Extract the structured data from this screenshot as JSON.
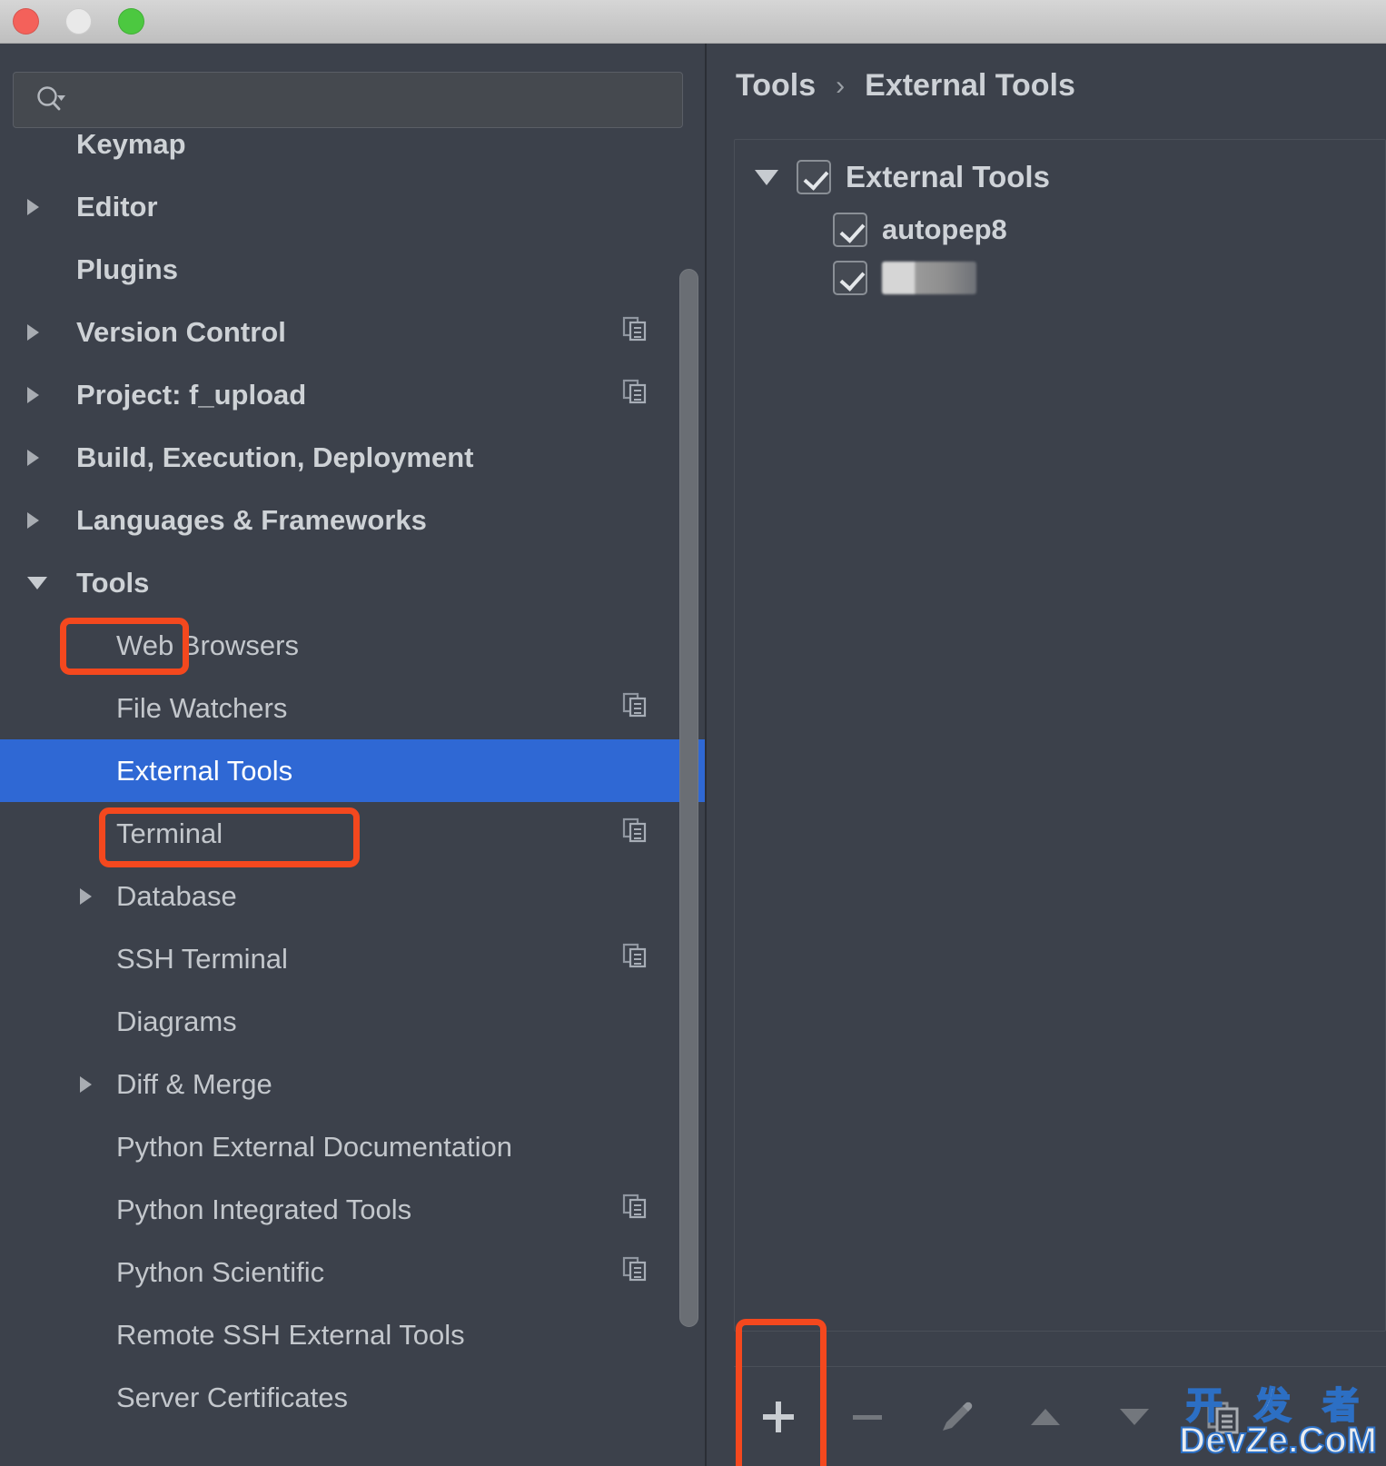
{
  "window": {
    "traffic_lights": [
      "close",
      "minimize",
      "maximize"
    ]
  },
  "search": {
    "value": "",
    "placeholder": "",
    "icon": "search-icon"
  },
  "sidebar": {
    "items": [
      {
        "label": "Keymap",
        "indent": 0,
        "arrow": "none",
        "copy": false,
        "partial": true
      },
      {
        "label": "Editor",
        "indent": 0,
        "arrow": "right",
        "copy": false
      },
      {
        "label": "Plugins",
        "indent": 0,
        "arrow": "none",
        "copy": false
      },
      {
        "label": "Version Control",
        "indent": 0,
        "arrow": "right",
        "copy": true
      },
      {
        "label": "Project: f_upload",
        "indent": 0,
        "arrow": "right",
        "copy": true
      },
      {
        "label": "Build, Execution, Deployment",
        "indent": 0,
        "arrow": "right",
        "copy": false
      },
      {
        "label": "Languages & Frameworks",
        "indent": 0,
        "arrow": "right",
        "copy": false
      },
      {
        "label": "Tools",
        "indent": 0,
        "arrow": "down",
        "copy": false,
        "highlighted": true
      },
      {
        "label": "Web Browsers",
        "indent": 1,
        "arrow": "none",
        "copy": false
      },
      {
        "label": "File Watchers",
        "indent": 1,
        "arrow": "none",
        "copy": true
      },
      {
        "label": "External Tools",
        "indent": 1,
        "arrow": "none",
        "copy": false,
        "selected": true,
        "highlighted": true
      },
      {
        "label": "Terminal",
        "indent": 1,
        "arrow": "none",
        "copy": true
      },
      {
        "label": "Database",
        "indent": 1,
        "arrow": "right",
        "copy": false
      },
      {
        "label": "SSH Terminal",
        "indent": 1,
        "arrow": "none",
        "copy": true
      },
      {
        "label": "Diagrams",
        "indent": 1,
        "arrow": "none",
        "copy": false
      },
      {
        "label": "Diff & Merge",
        "indent": 1,
        "arrow": "right",
        "copy": false
      },
      {
        "label": "Python External Documentation",
        "indent": 1,
        "arrow": "none",
        "copy": false
      },
      {
        "label": "Python Integrated Tools",
        "indent": 1,
        "arrow": "none",
        "copy": true
      },
      {
        "label": "Python Scientific",
        "indent": 1,
        "arrow": "none",
        "copy": true
      },
      {
        "label": "Remote SSH External Tools",
        "indent": 1,
        "arrow": "none",
        "copy": false
      },
      {
        "label": "Server Certificates",
        "indent": 1,
        "arrow": "none",
        "copy": false
      }
    ]
  },
  "breadcrumb": {
    "parent": "Tools",
    "separator": "›",
    "current": "External Tools"
  },
  "tool_tree": {
    "root": {
      "label": "External Tools",
      "checked": true,
      "expanded": true
    },
    "children": [
      {
        "label": "autopep8",
        "checked": true,
        "redacted": false
      },
      {
        "label": "",
        "checked": true,
        "redacted": true
      }
    ]
  },
  "toolbar": {
    "buttons": [
      {
        "name": "add-button",
        "icon": "plus-icon",
        "enabled": true,
        "highlighted": true
      },
      {
        "name": "remove-button",
        "icon": "minus-icon",
        "enabled": false
      },
      {
        "name": "edit-button",
        "icon": "pencil-icon",
        "enabled": false
      },
      {
        "name": "move-up-button",
        "icon": "arrow-up-icon",
        "enabled": false
      },
      {
        "name": "move-down-button",
        "icon": "arrow-down-icon",
        "enabled": false
      },
      {
        "name": "copy-button",
        "icon": "copy-icon",
        "enabled": true
      }
    ]
  },
  "watermark": {
    "line1": "开 发 者",
    "line2": "DevZe.CoM"
  },
  "colors": {
    "accent_selection": "#2F68D4",
    "annotation_red": "#F4481E",
    "panel_bg": "#3C414B",
    "text": "#C3C7CC"
  }
}
